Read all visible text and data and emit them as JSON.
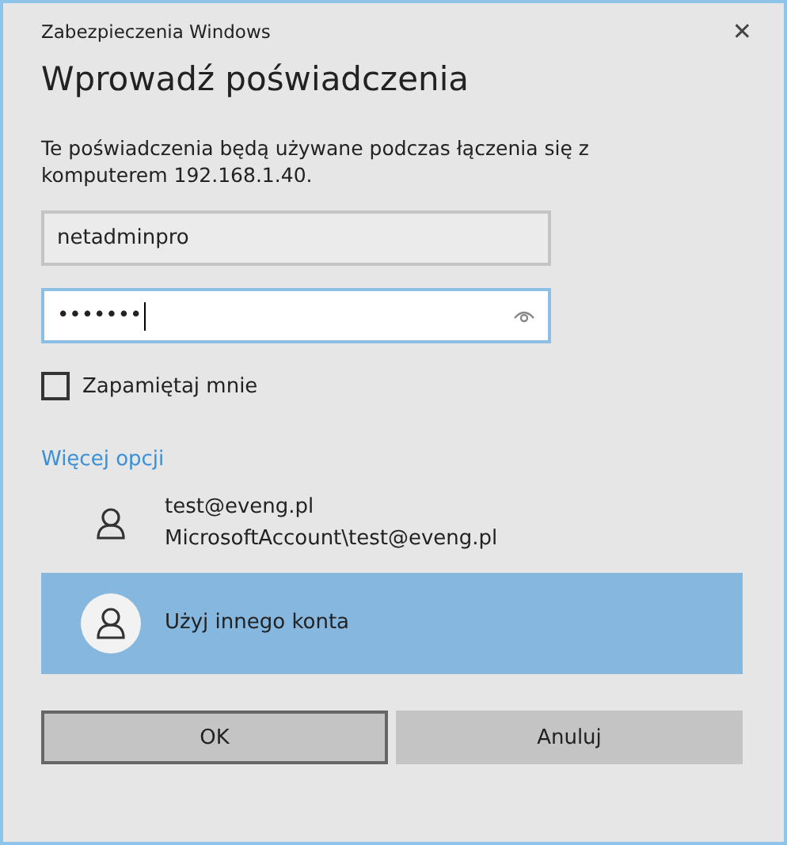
{
  "window": {
    "title": "Zabezpieczenia Windows",
    "close": "✕"
  },
  "heading": "Wprowadź poświadczenia",
  "description": "Te poświadczenia będą używane podczas łączenia się z komputerem 192.168.1.40.",
  "username": {
    "value": "netadminpro",
    "focused": false
  },
  "password": {
    "value": "•••••••",
    "focused": true
  },
  "remember": {
    "label": "Zapamiętaj mnie",
    "checked": false
  },
  "more_options": "Więcej opcji",
  "accounts": [
    {
      "lines": [
        "test@eveng.pl",
        "MicrosoftAccount\\test@eveng.pl"
      ],
      "selected": false
    },
    {
      "lines": [
        "Użyj innego konta"
      ],
      "selected": true
    }
  ],
  "buttons": [
    {
      "label": "OK",
      "focused": true
    },
    {
      "label": "Anuluj",
      "focused": false
    }
  ]
}
